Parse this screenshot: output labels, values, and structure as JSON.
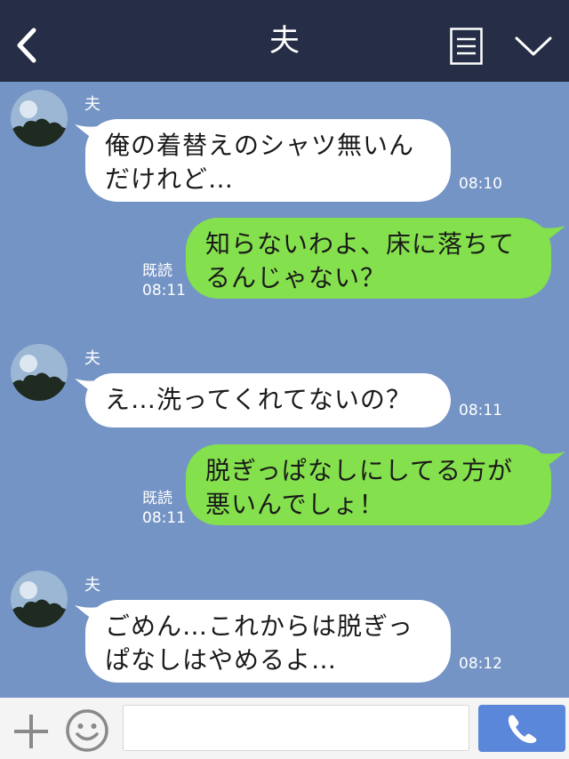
{
  "header": {
    "title": "夫",
    "icons": [
      "back-chevron-icon",
      "menu-list-icon",
      "chevron-down-icon"
    ]
  },
  "messages": [
    {
      "type": "incoming",
      "sender": "夫",
      "lines": [
        "俺の着替えのシャツ無いん",
        "だけれど…"
      ],
      "time": "08:10"
    },
    {
      "type": "outgoing",
      "lines": [
        "知らないわよ、床に落ちて",
        "るんじゃない？"
      ],
      "read": "既読",
      "time": "08:11"
    },
    {
      "type": "incoming",
      "sender": "夫",
      "lines": [
        "え…洗ってくれてないの？"
      ],
      "time": "08:11"
    },
    {
      "type": "outgoing",
      "lines": [
        "脱ぎっぱなしにしてる方が",
        "悪いんでしょ！"
      ],
      "read": "既読",
      "time": "08:11"
    },
    {
      "type": "incoming",
      "sender": "夫",
      "lines": [
        "ごめん…これからは脱ぎっ",
        "ぱなしはやめるよ…"
      ],
      "time": "08:12"
    }
  ],
  "footer": {
    "input_value": "",
    "icons": [
      "plus-icon",
      "smile-icon",
      "phone-icon"
    ]
  },
  "colors": {
    "header_bg": "#252e46",
    "chat_bg": "#7494c5",
    "outgoing_bubble": "#84e04c",
    "incoming_bubble": "#ffffff",
    "call_button": "#5a87d9"
  }
}
